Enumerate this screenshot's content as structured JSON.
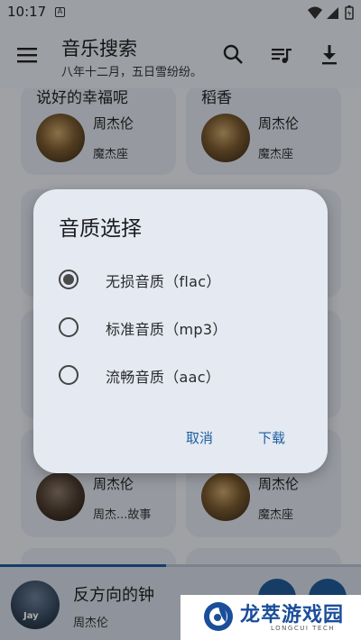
{
  "status": {
    "time": "10:17",
    "sim_letter": "A"
  },
  "header": {
    "title": "音乐搜索",
    "subtitle": "八年十二月，五日雪纷纷。",
    "icons": [
      "menu-icon",
      "search-icon",
      "playlist-icon",
      "download-icon"
    ]
  },
  "cards": [
    {
      "title": "说好的幸福呢",
      "artist": "周杰伦",
      "album": "魔杰座"
    },
    {
      "title": "稻香",
      "artist": "周杰伦",
      "album": "魔杰座"
    },
    {
      "title": "",
      "artist": "周杰伦",
      "album": "周杰...故事"
    },
    {
      "title": "",
      "artist": "周杰伦",
      "album": "魔杰座"
    }
  ],
  "dialog": {
    "title": "音质选择",
    "options": [
      {
        "label": "无损音质（flac）",
        "selected": true
      },
      {
        "label": "标准音质（mp3）",
        "selected": false
      },
      {
        "label": "流畅音质（aac）",
        "selected": false
      }
    ],
    "cancel_label": "取消",
    "confirm_label": "下载"
  },
  "player": {
    "title": "反方向的钟",
    "artist": "周杰伦",
    "cover_text": "Jay",
    "progress": 0.46
  },
  "watermark": {
    "name": "龙萃游戏园",
    "sub": "LONGCUI TECH"
  },
  "colors": {
    "accent": "#1f5a97",
    "dialog_bg": "#e4e9f2",
    "card_bg": "#dde3ec"
  }
}
